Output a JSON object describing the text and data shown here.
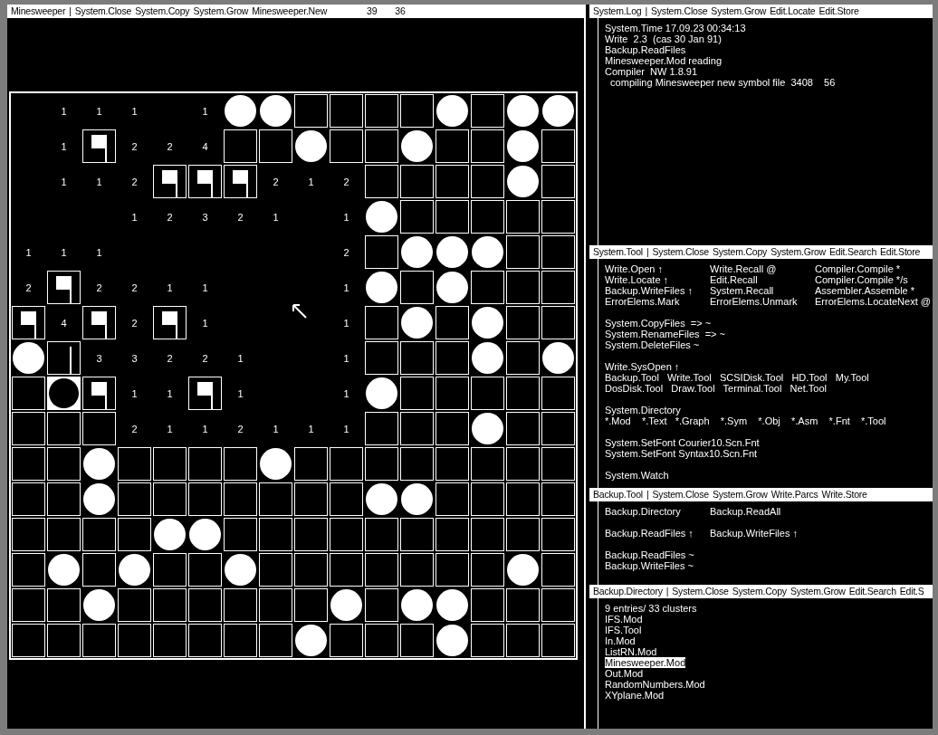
{
  "board_viewer": {
    "title": {
      "name": "Minesweeper",
      "separator": "|",
      "commands": [
        "System.Close",
        "System.Copy",
        "System.Grow",
        "Minesweeper.New"
      ],
      "counters": [
        "39",
        "36"
      ]
    },
    "rows": [
      [
        {
          "kind": "open"
        },
        {
          "kind": "number",
          "text": "1"
        },
        {
          "kind": "number",
          "text": "1"
        },
        {
          "kind": "number",
          "text": "1"
        },
        {
          "kind": "open"
        },
        {
          "kind": "number",
          "text": "1"
        },
        {
          "kind": "mine"
        },
        {
          "kind": "mine"
        },
        {
          "kind": "hidden"
        },
        {
          "kind": "hidden"
        },
        {
          "kind": "hidden"
        },
        {
          "kind": "hidden"
        },
        {
          "kind": "mine"
        },
        {
          "kind": "hidden"
        },
        {
          "kind": "mine"
        },
        {
          "kind": "mine"
        }
      ],
      [
        {
          "kind": "open"
        },
        {
          "kind": "number",
          "text": "1"
        },
        {
          "kind": "flag"
        },
        {
          "kind": "number",
          "text": "2"
        },
        {
          "kind": "number",
          "text": "2"
        },
        {
          "kind": "number",
          "text": "4"
        },
        {
          "kind": "hidden"
        },
        {
          "kind": "hidden"
        },
        {
          "kind": "mine"
        },
        {
          "kind": "hidden"
        },
        {
          "kind": "hidden"
        },
        {
          "kind": "mine"
        },
        {
          "kind": "hidden"
        },
        {
          "kind": "hidden"
        },
        {
          "kind": "mine"
        },
        {
          "kind": "hidden"
        }
      ],
      [
        {
          "kind": "open"
        },
        {
          "kind": "number",
          "text": "1"
        },
        {
          "kind": "number",
          "text": "1"
        },
        {
          "kind": "number",
          "text": "2"
        },
        {
          "kind": "flag"
        },
        {
          "kind": "flag"
        },
        {
          "kind": "flag"
        },
        {
          "kind": "number",
          "text": "2"
        },
        {
          "kind": "number",
          "text": "1"
        },
        {
          "kind": "number",
          "text": "2"
        },
        {
          "kind": "hidden"
        },
        {
          "kind": "hidden"
        },
        {
          "kind": "hidden"
        },
        {
          "kind": "hidden"
        },
        {
          "kind": "mine"
        },
        {
          "kind": "hidden"
        }
      ],
      [
        {
          "kind": "open"
        },
        {
          "kind": "open"
        },
        {
          "kind": "open"
        },
        {
          "kind": "number",
          "text": "1"
        },
        {
          "kind": "number",
          "text": "2"
        },
        {
          "kind": "number",
          "text": "3"
        },
        {
          "kind": "number",
          "text": "2"
        },
        {
          "kind": "number",
          "text": "1"
        },
        {
          "kind": "open"
        },
        {
          "kind": "number",
          "text": "1"
        },
        {
          "kind": "mine"
        },
        {
          "kind": "hidden"
        },
        {
          "kind": "hidden"
        },
        {
          "kind": "hidden"
        },
        {
          "kind": "hidden"
        },
        {
          "kind": "hidden"
        }
      ],
      [
        {
          "kind": "number",
          "text": "1"
        },
        {
          "kind": "number",
          "text": "1"
        },
        {
          "kind": "number",
          "text": "1"
        },
        {
          "kind": "open"
        },
        {
          "kind": "open"
        },
        {
          "kind": "open"
        },
        {
          "kind": "open"
        },
        {
          "kind": "open"
        },
        {
          "kind": "open"
        },
        {
          "kind": "number",
          "text": "2"
        },
        {
          "kind": "hidden"
        },
        {
          "kind": "mine"
        },
        {
          "kind": "mine"
        },
        {
          "kind": "mine"
        },
        {
          "kind": "hidden"
        },
        {
          "kind": "hidden"
        }
      ],
      [
        {
          "kind": "number",
          "text": "2"
        },
        {
          "kind": "flag"
        },
        {
          "kind": "number",
          "text": "2"
        },
        {
          "kind": "number",
          "text": "2"
        },
        {
          "kind": "number",
          "text": "1"
        },
        {
          "kind": "number",
          "text": "1"
        },
        {
          "kind": "open"
        },
        {
          "kind": "open"
        },
        {
          "kind": "open"
        },
        {
          "kind": "number",
          "text": "1"
        },
        {
          "kind": "mine"
        },
        {
          "kind": "hidden"
        },
        {
          "kind": "mine"
        },
        {
          "kind": "hidden"
        },
        {
          "kind": "hidden"
        },
        {
          "kind": "hidden"
        }
      ],
      [
        {
          "kind": "flag"
        },
        {
          "kind": "number",
          "text": "4"
        },
        {
          "kind": "flag"
        },
        {
          "kind": "number",
          "text": "2"
        },
        {
          "kind": "flag"
        },
        {
          "kind": "number",
          "text": "1"
        },
        {
          "kind": "open"
        },
        {
          "kind": "open"
        },
        {
          "kind": "open"
        },
        {
          "kind": "number",
          "text": "1"
        },
        {
          "kind": "hidden"
        },
        {
          "kind": "mine"
        },
        {
          "kind": "hidden"
        },
        {
          "kind": "mine"
        },
        {
          "kind": "hidden"
        },
        {
          "kind": "hidden"
        }
      ],
      [
        {
          "kind": "mine"
        },
        {
          "kind": "pole"
        },
        {
          "kind": "number",
          "text": "3"
        },
        {
          "kind": "number",
          "text": "3"
        },
        {
          "kind": "number",
          "text": "2"
        },
        {
          "kind": "number",
          "text": "2"
        },
        {
          "kind": "number",
          "text": "1"
        },
        {
          "kind": "open"
        },
        {
          "kind": "open"
        },
        {
          "kind": "number",
          "text": "1"
        },
        {
          "kind": "hidden"
        },
        {
          "kind": "hidden"
        },
        {
          "kind": "hidden"
        },
        {
          "kind": "mine"
        },
        {
          "kind": "hidden"
        },
        {
          "kind": "mine"
        }
      ],
      [
        {
          "kind": "hidden"
        },
        {
          "kind": "exploded"
        },
        {
          "kind": "flag"
        },
        {
          "kind": "number",
          "text": "1"
        },
        {
          "kind": "number",
          "text": "1"
        },
        {
          "kind": "flag"
        },
        {
          "kind": "number",
          "text": "1"
        },
        {
          "kind": "open"
        },
        {
          "kind": "open"
        },
        {
          "kind": "number",
          "text": "1"
        },
        {
          "kind": "mine"
        },
        {
          "kind": "hidden"
        },
        {
          "kind": "hidden"
        },
        {
          "kind": "hidden"
        },
        {
          "kind": "hidden"
        },
        {
          "kind": "hidden"
        }
      ],
      [
        {
          "kind": "hidden"
        },
        {
          "kind": "hidden"
        },
        {
          "kind": "hidden"
        },
        {
          "kind": "number",
          "text": "2"
        },
        {
          "kind": "number",
          "text": "1"
        },
        {
          "kind": "number",
          "text": "1"
        },
        {
          "kind": "number",
          "text": "2"
        },
        {
          "kind": "number",
          "text": "1"
        },
        {
          "kind": "number",
          "text": "1"
        },
        {
          "kind": "number",
          "text": "1"
        },
        {
          "kind": "hidden"
        },
        {
          "kind": "hidden"
        },
        {
          "kind": "hidden"
        },
        {
          "kind": "mine"
        },
        {
          "kind": "hidden"
        },
        {
          "kind": "hidden"
        }
      ],
      [
        {
          "kind": "hidden"
        },
        {
          "kind": "hidden"
        },
        {
          "kind": "mine"
        },
        {
          "kind": "hidden"
        },
        {
          "kind": "hidden"
        },
        {
          "kind": "hidden"
        },
        {
          "kind": "hidden"
        },
        {
          "kind": "mine"
        },
        {
          "kind": "hidden"
        },
        {
          "kind": "hidden"
        },
        {
          "kind": "hidden"
        },
        {
          "kind": "hidden"
        },
        {
          "kind": "hidden"
        },
        {
          "kind": "hidden"
        },
        {
          "kind": "hidden"
        },
        {
          "kind": "hidden"
        }
      ],
      [
        {
          "kind": "hidden"
        },
        {
          "kind": "hidden"
        },
        {
          "kind": "mine"
        },
        {
          "kind": "hidden"
        },
        {
          "kind": "hidden"
        },
        {
          "kind": "hidden"
        },
        {
          "kind": "hidden"
        },
        {
          "kind": "hidden"
        },
        {
          "kind": "hidden"
        },
        {
          "kind": "hidden"
        },
        {
          "kind": "mine"
        },
        {
          "kind": "mine"
        },
        {
          "kind": "hidden"
        },
        {
          "kind": "hidden"
        },
        {
          "kind": "hidden"
        },
        {
          "kind": "hidden"
        }
      ],
      [
        {
          "kind": "hidden"
        },
        {
          "kind": "hidden"
        },
        {
          "kind": "hidden"
        },
        {
          "kind": "hidden"
        },
        {
          "kind": "mine"
        },
        {
          "kind": "mine"
        },
        {
          "kind": "hidden"
        },
        {
          "kind": "hidden"
        },
        {
          "kind": "hidden"
        },
        {
          "kind": "hidden"
        },
        {
          "kind": "hidden"
        },
        {
          "kind": "hidden"
        },
        {
          "kind": "hidden"
        },
        {
          "kind": "hidden"
        },
        {
          "kind": "hidden"
        },
        {
          "kind": "hidden"
        }
      ],
      [
        {
          "kind": "hidden"
        },
        {
          "kind": "mine"
        },
        {
          "kind": "hidden"
        },
        {
          "kind": "mine"
        },
        {
          "kind": "hidden"
        },
        {
          "kind": "hidden"
        },
        {
          "kind": "mine"
        },
        {
          "kind": "hidden"
        },
        {
          "kind": "hidden"
        },
        {
          "kind": "hidden"
        },
        {
          "kind": "hidden"
        },
        {
          "kind": "hidden"
        },
        {
          "kind": "hidden"
        },
        {
          "kind": "hidden"
        },
        {
          "kind": "mine"
        },
        {
          "kind": "hidden"
        }
      ],
      [
        {
          "kind": "hidden"
        },
        {
          "kind": "hidden"
        },
        {
          "kind": "mine"
        },
        {
          "kind": "hidden"
        },
        {
          "kind": "hidden"
        },
        {
          "kind": "hidden"
        },
        {
          "kind": "hidden"
        },
        {
          "kind": "hidden"
        },
        {
          "kind": "hidden"
        },
        {
          "kind": "mine"
        },
        {
          "kind": "hidden"
        },
        {
          "kind": "mine"
        },
        {
          "kind": "mine"
        },
        {
          "kind": "hidden"
        },
        {
          "kind": "hidden"
        },
        {
          "kind": "hidden"
        }
      ],
      [
        {
          "kind": "hidden"
        },
        {
          "kind": "hidden"
        },
        {
          "kind": "hidden"
        },
        {
          "kind": "hidden"
        },
        {
          "kind": "hidden"
        },
        {
          "kind": "hidden"
        },
        {
          "kind": "hidden"
        },
        {
          "kind": "hidden"
        },
        {
          "kind": "mine"
        },
        {
          "kind": "hidden"
        },
        {
          "kind": "hidden"
        },
        {
          "kind": "hidden"
        },
        {
          "kind": "mine"
        },
        {
          "kind": "hidden"
        },
        {
          "kind": "hidden"
        },
        {
          "kind": "hidden"
        }
      ]
    ]
  },
  "viewers": [
    {
      "title": {
        "name": "System.Log",
        "separator": "|",
        "commands": [
          "System.Close",
          "System.Grow",
          "Edit.Locate",
          "Edit.Store"
        ]
      },
      "lines": [
        {
          "kind": "text",
          "text": "System.Time 17.09.23 00:34:13"
        },
        {
          "kind": "text",
          "text": "Write  2.3  (cas 30 Jan 91)"
        },
        {
          "kind": "text",
          "text": "Backup.ReadFiles"
        },
        {
          "kind": "text",
          "text": "Minesweeper.Mod reading"
        },
        {
          "kind": "text",
          "text": "Compiler  NW 1.8.91"
        },
        {
          "kind": "text",
          "text": "  compiling Minesweeper new symbol file  3408    56"
        }
      ]
    },
    {
      "title": {
        "name": "System.Tool",
        "separator": "|",
        "commands": [
          "System.Close",
          "System.Copy",
          "System.Grow",
          "Edit.Search",
          "Edit.Store"
        ]
      },
      "lines": [
        {
          "kind": "columns",
          "cells": [
            "Write.Open ↑",
            "Write.Recall @",
            "Compiler.Compile *"
          ]
        },
        {
          "kind": "columns",
          "cells": [
            "Write.Locate ↑",
            "Edit.Recall",
            "Compiler.Compile */s"
          ]
        },
        {
          "kind": "columns",
          "cells": [
            "Backup.WriteFiles ↑",
            "System.Recall",
            "Assembler.Assemble *"
          ]
        },
        {
          "kind": "columns",
          "cells": [
            "ErrorElems.Mark",
            "ErrorElems.Unmark",
            "ErrorElems.LocateNext @"
          ]
        },
        {
          "kind": "blank"
        },
        {
          "kind": "command",
          "text": "System.CopyFiles  => ~"
        },
        {
          "kind": "command",
          "text": "System.RenameFiles  => ~"
        },
        {
          "kind": "command",
          "text": "System.DeleteFiles ~"
        },
        {
          "kind": "blank"
        },
        {
          "kind": "command",
          "text": "Write.SysOpen ↑"
        },
        {
          "kind": "command",
          "text": "Backup.Tool   Write.Tool   SCSIDisk.Tool   HD.Tool   My.Tool"
        },
        {
          "kind": "command",
          "text": "DosDisk.Tool   Draw.Tool   Terminal.Tool   Net.Tool"
        },
        {
          "kind": "blank"
        },
        {
          "kind": "command",
          "text": "System.Directory"
        },
        {
          "kind": "command",
          "text": "*.Mod    *.Text   *.Graph    *.Sym    *.Obj    *.Asm    *.Fnt    *.Tool"
        },
        {
          "kind": "blank"
        },
        {
          "kind": "command",
          "text": "System.SetFont Courier10.Scn.Fnt"
        },
        {
          "kind": "command",
          "text": "System.SetFont Syntax10.Scn.Fnt"
        },
        {
          "kind": "blank"
        },
        {
          "kind": "command",
          "text": "System.Watch"
        }
      ]
    },
    {
      "title": {
        "name": "Backup.Tool",
        "separator": "|",
        "commands": [
          "System.Close",
          "System.Grow",
          "Write.Parcs",
          "Write.Store"
        ]
      },
      "lines": [
        {
          "kind": "columns",
          "cells": [
            "Backup.Directory",
            "Backup.ReadAll"
          ]
        },
        {
          "kind": "blank"
        },
        {
          "kind": "columns",
          "cells": [
            "Backup.ReadFiles ↑",
            "Backup.WriteFiles ↑"
          ]
        },
        {
          "kind": "blank"
        },
        {
          "kind": "command",
          "text": "Backup.ReadFiles ~"
        },
        {
          "kind": "command",
          "text": "Backup.WriteFiles ~"
        }
      ]
    },
    {
      "title": {
        "name": "Backup.Directory",
        "separator": "|",
        "commands": [
          "System.Close",
          "System.Copy",
          "System.Grow",
          "Edit.Search",
          "Edit.S"
        ]
      },
      "lines": [
        {
          "kind": "text",
          "text": "9 entries/ 33 clusters"
        },
        {
          "kind": "entry",
          "text": "IFS.Mod",
          "selected": false
        },
        {
          "kind": "entry",
          "text": "IFS.Tool",
          "selected": false
        },
        {
          "kind": "entry",
          "text": "In.Mod",
          "selected": false
        },
        {
          "kind": "entry",
          "text": "ListRN.Mod",
          "selected": false
        },
        {
          "kind": "entry",
          "text": "Minesweeper.Mod",
          "selected": true
        },
        {
          "kind": "entry",
          "text": "Out.Mod",
          "selected": false
        },
        {
          "kind": "entry",
          "text": "RandomNumbers.Mod",
          "selected": false
        },
        {
          "kind": "entry",
          "text": "XYplane.Mod",
          "selected": false
        }
      ]
    }
  ]
}
